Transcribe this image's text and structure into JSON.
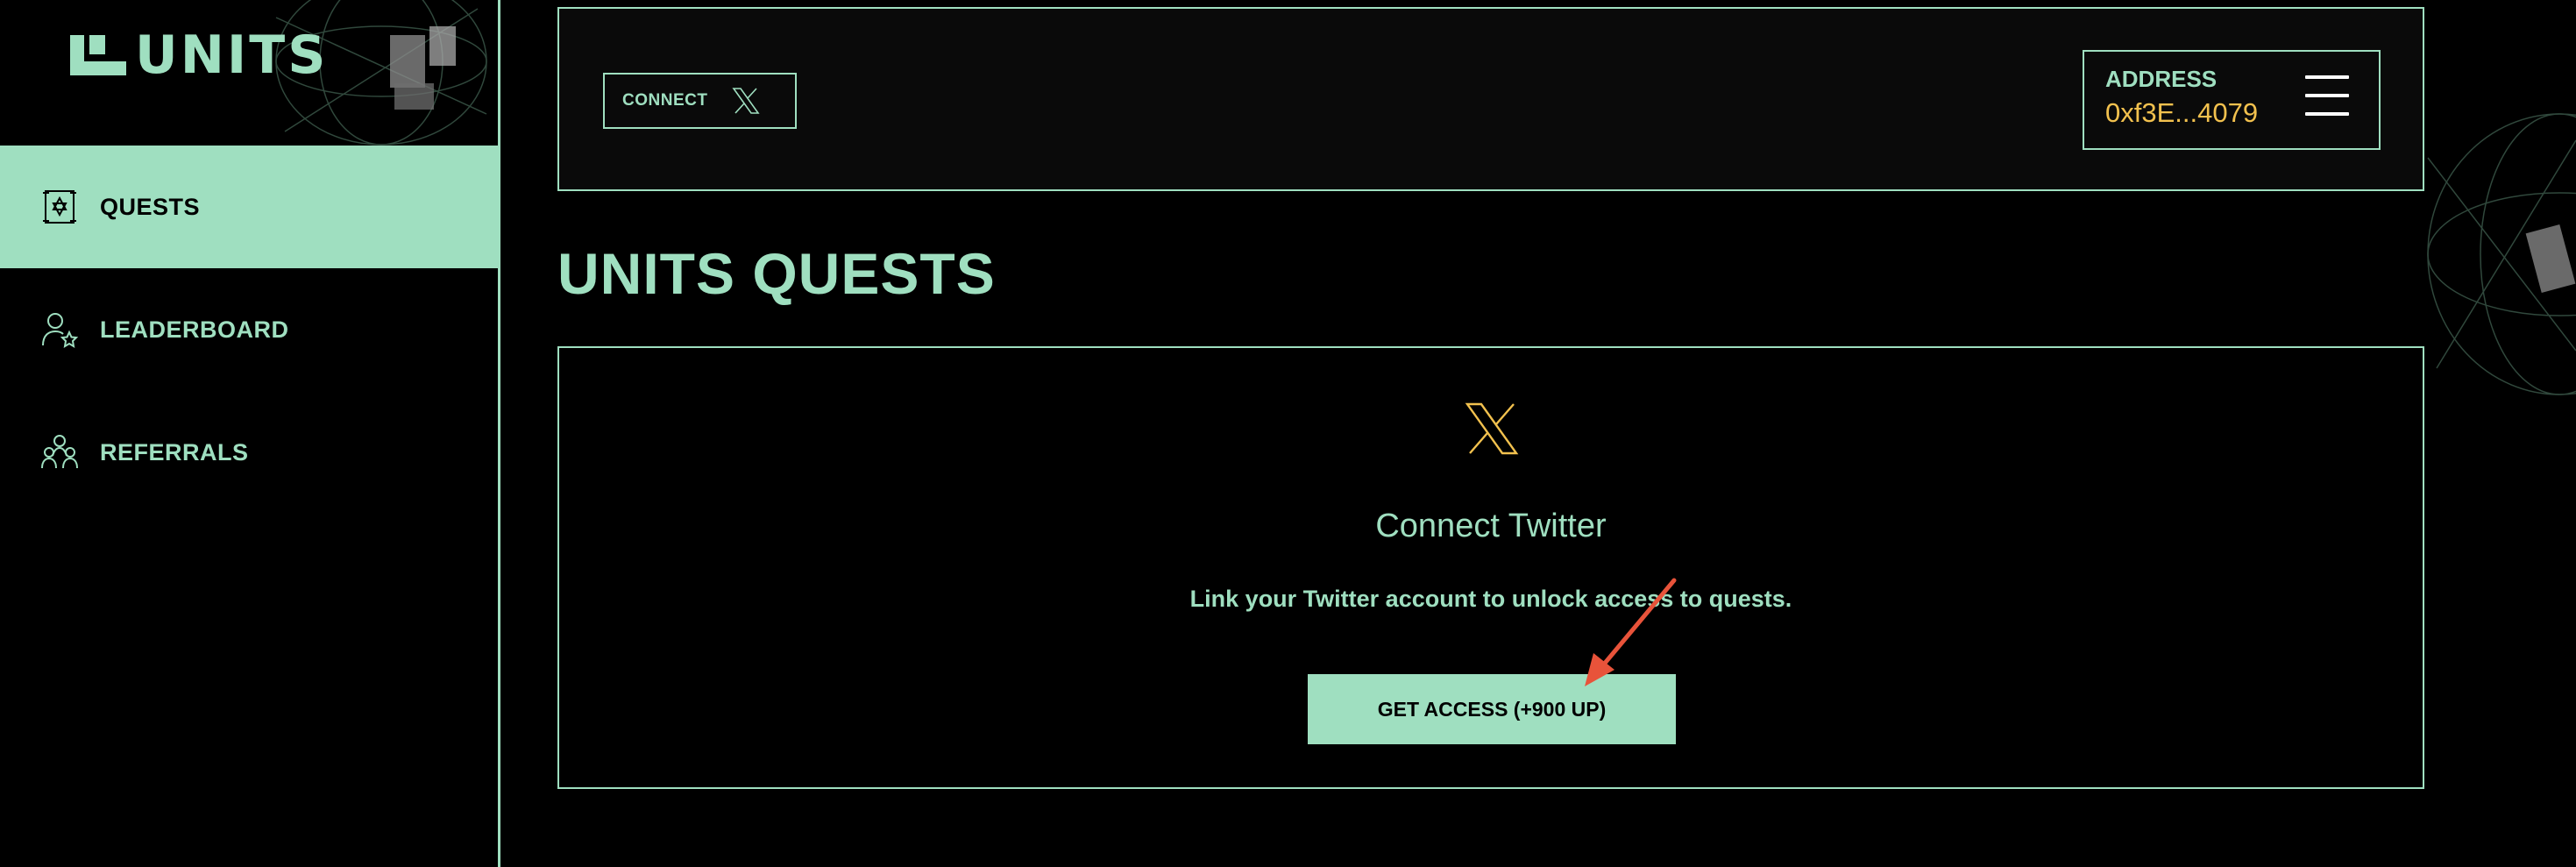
{
  "app": {
    "logo_text": "UNITS"
  },
  "sidebar": {
    "items": [
      {
        "label": "QUESTS",
        "icon": "quest-icon",
        "active": true
      },
      {
        "label": "LEADERBOARD",
        "icon": "leaderboard-icon",
        "active": false
      },
      {
        "label": "REFERRALS",
        "icon": "referrals-icon",
        "active": false
      }
    ]
  },
  "header": {
    "connect_label": "CONNECT",
    "connect_icon": "x-logo-icon",
    "address_label": "ADDRESS",
    "address_value": "0xf3E...4079",
    "menu_icon": "hamburger-menu-icon"
  },
  "main": {
    "title": "UNITS QUESTS",
    "quest": {
      "icon": "x-logo-icon",
      "title": "Connect Twitter",
      "description": "Link your Twitter account to unlock access to quests.",
      "button_label": "GET ACCESS (+900 UP)"
    }
  },
  "colors": {
    "accent": "#9fdfc0",
    "address": "#f2c14e",
    "background": "#000000",
    "annotation_arrow": "#e8533a"
  }
}
